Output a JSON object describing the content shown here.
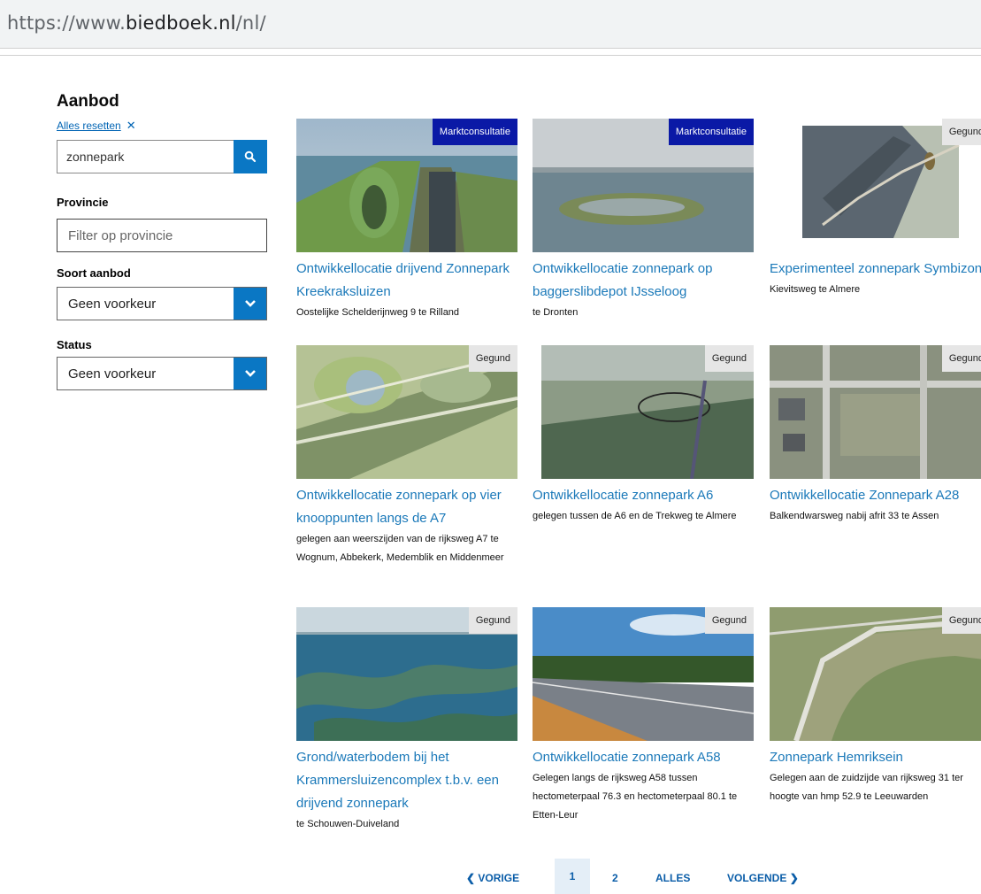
{
  "browser": {
    "url_prefix": "https://www.",
    "url_domain": "biedboek.nl",
    "url_suffix": "/nl/"
  },
  "sidebar": {
    "title": "Aanbod",
    "reset_label": "Alles resetten",
    "reset_icon": "✕",
    "search_value": "zonnepark",
    "provincie_label": "Provincie",
    "provincie_placeholder": "Filter op provincie",
    "soort_label": "Soort aanbod",
    "soort_value": "Geen voorkeur",
    "status_label": "Status",
    "status_value": "Geen voorkeur"
  },
  "results": [
    {
      "badge": "Marktconsultatie",
      "badge_type": "blue",
      "title": "Ontwikkellocatie drijvend Zonnepark Kreekraksluizen",
      "address": "Oostelijke Schelderijnweg 9 te Rilland"
    },
    {
      "badge": "Marktconsultatie",
      "badge_type": "blue",
      "title": "Ontwikkellocatie zonnepark op baggerslibdepot IJsseloog",
      "address": "te Dronten"
    },
    {
      "badge": "Gegund",
      "badge_type": "grey",
      "title": "Experimenteel zonnepark Symbizon",
      "address": "Kievitsweg te Almere"
    },
    {
      "badge": "Gegund",
      "badge_type": "grey",
      "title": "Ontwikkellocatie zonnepark op vier knooppunten langs de A7",
      "address": "gelegen aan weerszijden van de rijksweg A7 te Wognum, Abbekerk, Medemblik en Middenmeer"
    },
    {
      "badge": "Gegund",
      "badge_type": "grey",
      "title": "Ontwikkellocatie zonnepark A6",
      "address": "gelegen tussen de A6 en de Trekweg te Almere"
    },
    {
      "badge": "Gegund",
      "badge_type": "grey",
      "title": "Ontwikkellocatie Zonnepark A28",
      "address": "Balkendwarsweg nabij afrit 33 te Assen"
    },
    {
      "badge": "Gegund",
      "badge_type": "grey",
      "title": "Grond/waterbodem bij het Krammersluizencomplex t.b.v. een drijvend zonnepark",
      "address": "te Schouwen-Duiveland"
    },
    {
      "badge": "Gegund",
      "badge_type": "grey",
      "title": "Ontwikkellocatie zonnepark A58",
      "address": "Gelegen langs de rijksweg A58 tussen hectometerpaal 76.3 en hectometerpaal 80.1 te Etten-Leur"
    },
    {
      "badge": "Gegund",
      "badge_type": "grey",
      "title": "Zonnepark Hemriksein",
      "address": "Gelegen aan de zuidzijde van rijksweg 31 ter hoogte van hmp 52.9 te Leeuwarden"
    }
  ],
  "pagination": {
    "prev": "VORIGE",
    "pages": [
      "1",
      "2"
    ],
    "current": "1",
    "all": "ALLES",
    "next": "VOLGENDE"
  }
}
